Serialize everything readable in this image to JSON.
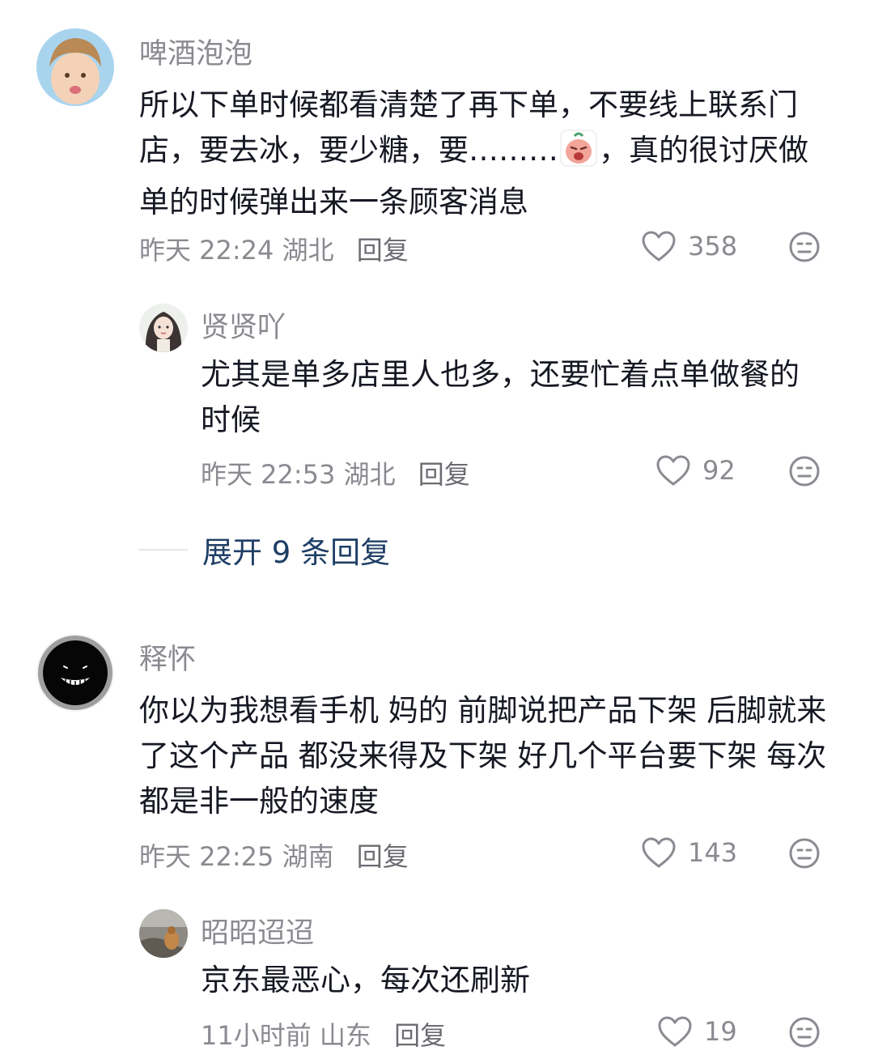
{
  "comments": [
    {
      "name": "啤酒泡泡",
      "text_a": "所以下单时候都看清楚了再下单，不要线上联系门店，要去冰，要少糖，要………",
      "text_b": "，真的很讨厌做单的时候弹出来一条顾客消息",
      "time": "昨天 22:24",
      "location": "湖北",
      "reply_label": "回复",
      "likes": "358",
      "sticker_icon": "crying-face-sticker"
    },
    {
      "name": "贤贤吖",
      "text": "尤其是单多店里人也多，还要忙着点单做餐的时候",
      "time": "昨天 22:53",
      "location": "湖北",
      "reply_label": "回复",
      "likes": "92"
    },
    {
      "name": "释怀",
      "text": "你以为我想看手机 妈的 前脚说把产品下架 后脚就来了这个产品 都没来得及下架 好几个平台要下架 每次都是非一般的速度",
      "time": "昨天 22:25",
      "location": "湖南",
      "reply_label": "回复",
      "likes": "143"
    },
    {
      "name": "昭昭迢迢",
      "text": "京东最恶心，每次还刷新",
      "time": "11小时前",
      "location": "山东",
      "reply_label": "回复",
      "likes": "19"
    }
  ],
  "expand_replies_label": "展开 9 条回复",
  "icons": {
    "like": "heart-outline-icon",
    "dislike": "meh-face-icon"
  },
  "colors": {
    "primary_text": "#161823",
    "secondary_text": "#8a8b91",
    "link": "#1f3f66"
  }
}
